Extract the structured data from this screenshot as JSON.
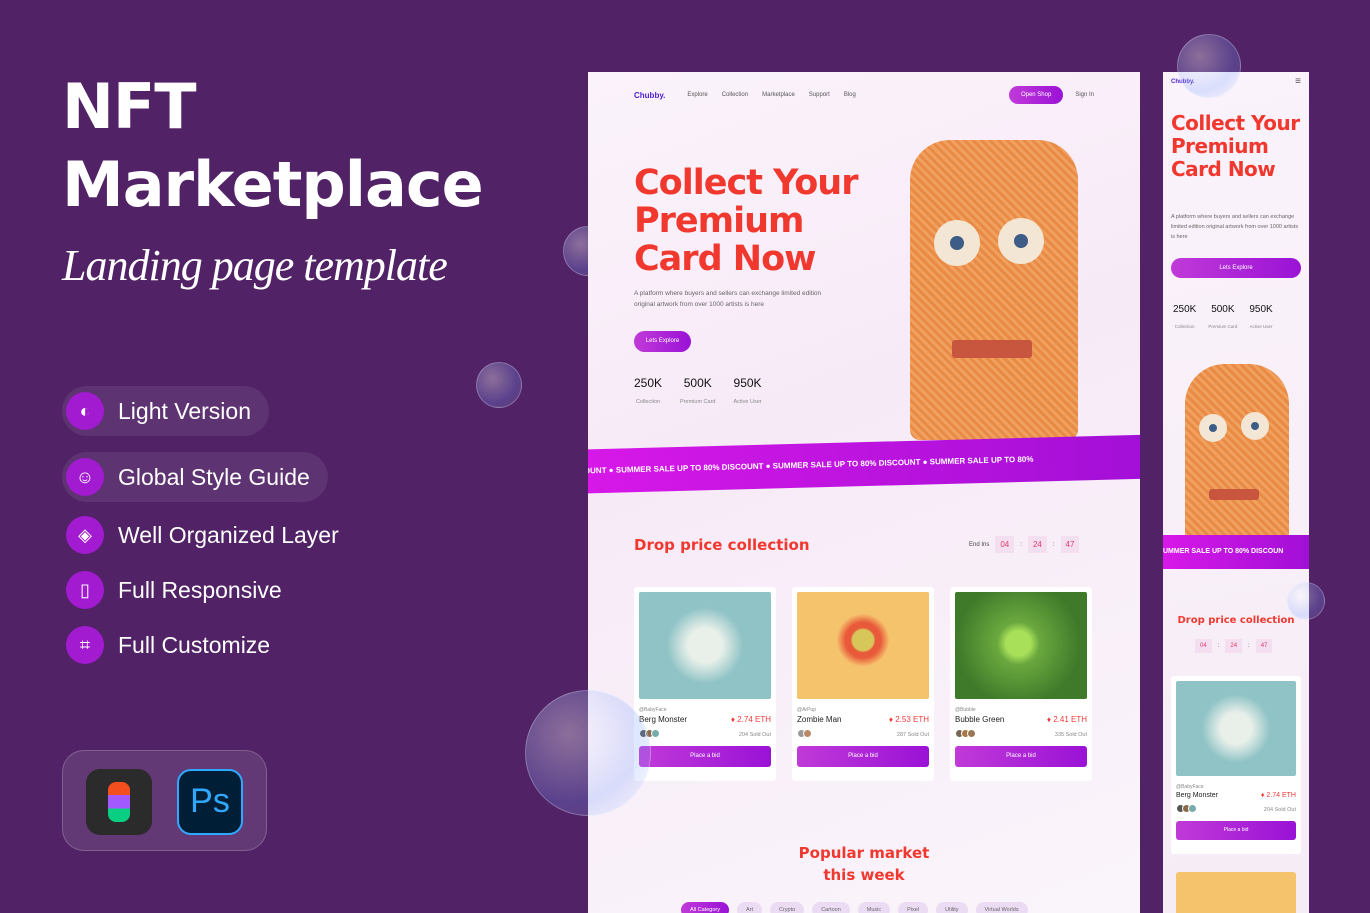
{
  "promo": {
    "title_line1": "NFT",
    "title_line2": "Marketplace",
    "subtitle": "Landing page template",
    "features": [
      {
        "label": "Light Version",
        "icon": "contrast-icon"
      },
      {
        "label": "Global Style Guide",
        "icon": "palette-icon"
      },
      {
        "label": "Well Organized Layer",
        "icon": "layers-icon"
      },
      {
        "label": "Full Responsive",
        "icon": "phone-icon"
      },
      {
        "label": "Full Customize",
        "icon": "crop-icon"
      }
    ],
    "tools": {
      "figma": "Figma",
      "photoshop": "Ps"
    }
  },
  "site": {
    "logo": "Chubby.",
    "nav": [
      "Explore",
      "Collection",
      "Marketplace",
      "Support",
      "Blog"
    ],
    "open_shop": "Open Shop",
    "sign_in": "Sign In",
    "hero_title": [
      "Collect Your",
      "Premium",
      "Card Now"
    ],
    "hero_desc": "A platform where buyers and sellers can exchange limited edition original artwork from over 1000 artists is here",
    "cta": "Lets Explore",
    "stats": [
      {
        "value": "250K",
        "label": "Collection"
      },
      {
        "value": "500K",
        "label": "Premium Card"
      },
      {
        "value": "950K",
        "label": "Active User"
      }
    ],
    "banner": "COUNT  ●  SUMMER SALE UP TO 80% DISCOUNT  ●  SUMMER SALE UP TO 80% DISCOUNT  ●  SUMMER SALE UP TO 80%",
    "mobile_banner": "UMMER SALE UP TO 80% DISCOUN",
    "drop_title": "Drop price collection",
    "ends_in": "End Ins",
    "timer": [
      "04",
      "24",
      "47"
    ],
    "cards": [
      {
        "handle": "@BabyFace",
        "name": "Berg Monster",
        "price": "2.74 ETH",
        "sold": "204 Sold Out",
        "bid": "Place a bid",
        "color": "#8fc3c6"
      },
      {
        "handle": "@ArPup",
        "name": "Zombie Man",
        "price": "2.53 ETH",
        "sold": "287 Sold Out",
        "bid": "Place a bid",
        "color": "#f6c36d"
      },
      {
        "handle": "@Bubble",
        "name": "Bubble Green",
        "price": "2.41 ETH",
        "sold": "335 Sold Out",
        "bid": "Place a bid",
        "color": "#5f9a3a"
      }
    ],
    "popular_title": [
      "Popular market",
      "this week"
    ],
    "categories": [
      "All Category",
      "Art",
      "Crypto",
      "Cartoon",
      "Music",
      "Pixel",
      "Utility",
      "Virtual Worlds"
    ],
    "accent": "#f0382f",
    "brand": "#a21bd0"
  }
}
